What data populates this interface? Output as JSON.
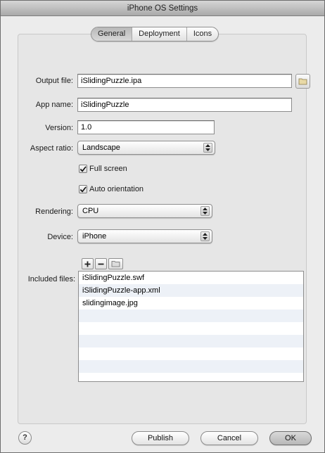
{
  "window": {
    "title": "iPhone OS Settings"
  },
  "tabs": [
    "General",
    "Deployment",
    "Icons"
  ],
  "active_tab": "General",
  "fields": {
    "output_file": {
      "label": "Output file:",
      "value": "iSlidingPuzzle.ipa"
    },
    "app_name": {
      "label": "App name:",
      "value": "iSlidingPuzzle"
    },
    "version": {
      "label": "Version:",
      "value": "1.0"
    },
    "aspect_ratio": {
      "label": "Aspect ratio:",
      "value": "Landscape"
    },
    "full_screen": {
      "label": "Full screen",
      "checked": true
    },
    "auto_orientation": {
      "label": "Auto orientation",
      "checked": true
    },
    "rendering": {
      "label": "Rendering:",
      "value": "CPU"
    },
    "device": {
      "label": "Device:",
      "value": "iPhone"
    }
  },
  "included_files": {
    "label": "Included files:",
    "items": [
      "iSlidingPuzzle.swf",
      "iSlidingPuzzle-app.xml",
      "slidingimage.jpg"
    ],
    "toolbar_icons": [
      "plus-icon",
      "minus-icon",
      "folder-icon"
    ]
  },
  "buttons": {
    "help": "?",
    "publish": "Publish",
    "cancel": "Cancel",
    "ok": "OK"
  },
  "colors": {
    "window_bg": "#ececec",
    "list_alt_row": "#edf1f7"
  }
}
